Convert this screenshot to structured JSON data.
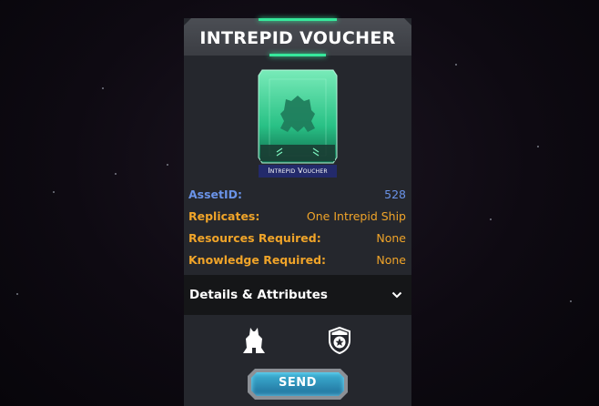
{
  "card": {
    "title": "INTREPID VOUCHER",
    "image_label": "Intrepid Voucher",
    "fields": [
      {
        "label": "AssetID:",
        "value": "528",
        "color": "#6a93e8"
      },
      {
        "label": "Replicates:",
        "value": "One Intrepid Ship",
        "color": "#f0a429"
      },
      {
        "label": "Resources Required:",
        "value": "None",
        "color": "#f0a429"
      },
      {
        "label": "Knowledge Required:",
        "value": "None",
        "color": "#f0a429"
      }
    ],
    "details_label": "Details & Attributes",
    "details_icon": "chevron-down-icon",
    "action_icons": [
      "ship-icon",
      "shield-star-icon"
    ],
    "send_label": "SEND"
  },
  "colors": {
    "accent_green": "#36e89b",
    "card_bg": "#25272d",
    "send_button": "#2a8fb8"
  }
}
